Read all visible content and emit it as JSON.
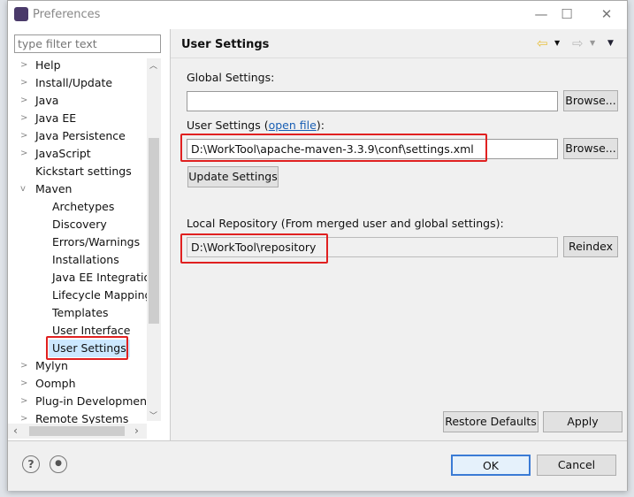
{
  "window": {
    "title": "Preferences",
    "minimize": "—",
    "maximize": "☐",
    "close": "✕"
  },
  "filter": {
    "placeholder": "type filter text"
  },
  "tree": [
    {
      "label": "Help",
      "twisty": ">"
    },
    {
      "label": "Install/Update",
      "twisty": ">"
    },
    {
      "label": "Java",
      "twisty": ">"
    },
    {
      "label": "Java EE",
      "twisty": ">"
    },
    {
      "label": "Java Persistence",
      "twisty": ">"
    },
    {
      "label": "JavaScript",
      "twisty": ">"
    },
    {
      "label": "Kickstart settings",
      "twisty": ""
    },
    {
      "label": "Maven",
      "twisty": "v"
    },
    {
      "label": "Archetypes",
      "child": true
    },
    {
      "label": "Discovery",
      "child": true
    },
    {
      "label": "Errors/Warnings",
      "child": true
    },
    {
      "label": "Installations",
      "child": true
    },
    {
      "label": "Java EE Integration",
      "child": true
    },
    {
      "label": "Lifecycle Mappings",
      "child": true
    },
    {
      "label": "Templates",
      "child": true
    },
    {
      "label": "User Interface",
      "child": true
    },
    {
      "label": "User Settings",
      "child": true,
      "selected": true
    },
    {
      "label": "Mylyn",
      "twisty": ">"
    },
    {
      "label": "Oomph",
      "twisty": ">"
    },
    {
      "label": "Plug-in Development",
      "twisty": ">"
    },
    {
      "label": "Remote Systems",
      "twisty": ">"
    }
  ],
  "page": {
    "title": "User Settings",
    "global_label": "Global Settings:",
    "global_value": "",
    "browse": "Browse...",
    "user_label": "User Settings (",
    "user_link": "open file",
    "user_label_end": "):",
    "user_value": "D:\\WorkTool\\apache-maven-3.3.9\\conf\\settings.xml",
    "update": "Update Settings",
    "local_label": "Local Repository (From merged user and global settings):",
    "local_value": "D:\\WorkTool\\repository",
    "reindex": "Reindex",
    "restore": "Restore Defaults",
    "apply": "Apply"
  },
  "footer": {
    "ok": "OK",
    "cancel": "Cancel",
    "help": "?"
  },
  "colors": {
    "highlight": "#e02020",
    "nav_back": "#e8c040"
  }
}
